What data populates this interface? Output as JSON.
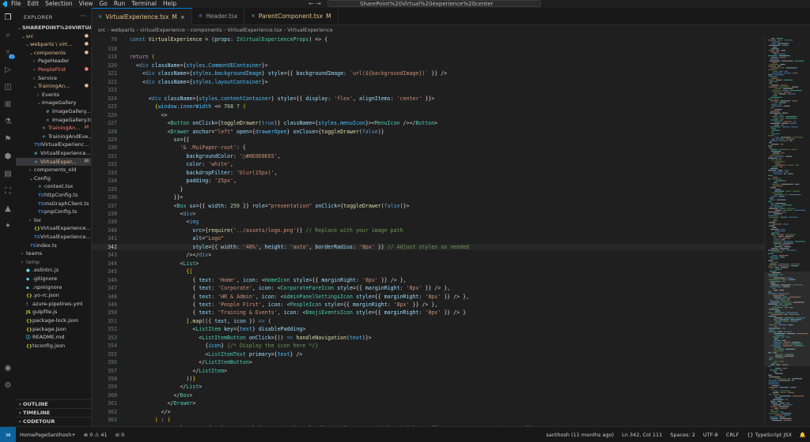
{
  "menubar": [
    "File",
    "Edit",
    "Selection",
    "View",
    "Go",
    "Run",
    "Terminal",
    "Help"
  ],
  "search": {
    "text": "SharePoint%20Virtual%20experience%20center"
  },
  "explorer": {
    "title": "EXPLORER",
    "items": [
      {
        "label": "SHAREPOINT%20VIRTUAL...",
        "color": "c-white",
        "chev": "⌄",
        "indent": 0,
        "badge": "",
        "bold": true
      },
      {
        "label": "src",
        "color": "c-orange",
        "chev": "⌄",
        "indent": 1,
        "badge": "●"
      },
      {
        "label": "webparts \\ virt...",
        "color": "c-orange",
        "chev": "⌄",
        "indent": 2,
        "badge": "●"
      },
      {
        "label": "components",
        "color": "c-orange",
        "chev": "⌄",
        "indent": 3,
        "badge": "●"
      },
      {
        "label": "PageHeader",
        "color": "c-white",
        "chev": "›",
        "indent": 4,
        "badge": ""
      },
      {
        "label": "PeopleFirst",
        "color": "c-red",
        "chev": "›",
        "indent": 4,
        "badge": "●"
      },
      {
        "label": "Service",
        "color": "c-white",
        "chev": "›",
        "indent": 4,
        "badge": ""
      },
      {
        "label": "TrainingAn...",
        "color": "c-orange",
        "chev": "⌄",
        "indent": 4,
        "badge": "●"
      },
      {
        "label": "Events",
        "color": "c-white",
        "chev": "›",
        "indent": 5,
        "badge": ""
      },
      {
        "label": "ImageGallery",
        "color": "c-white",
        "chev": "⌄",
        "indent": 5,
        "badge": ""
      },
      {
        "label": "ImageGallery...",
        "color": "c-white",
        "chev": "",
        "indent": 6,
        "badge": "",
        "icon": "#"
      },
      {
        "label": "ImageGallery.tsx",
        "color": "c-white",
        "chev": "",
        "indent": 6,
        "badge": "",
        "icon": "⚛"
      },
      {
        "label": "TrainingAn...",
        "color": "c-red",
        "chev": "",
        "indent": 5,
        "badge": "M",
        "icon": "⚛"
      },
      {
        "label": "TrainingAndEve...",
        "color": "c-white",
        "chev": "",
        "indent": 5,
        "badge": "",
        "icon": "⚛"
      },
      {
        "label": "IVirtualExperienc...",
        "color": "c-white",
        "chev": "",
        "indent": 3,
        "badge": "",
        "icon": "TS"
      },
      {
        "label": "VirtualExperience...",
        "color": "c-white",
        "chev": "",
        "indent": 3,
        "badge": "",
        "icon": "#"
      },
      {
        "label": "VirtualExper...",
        "color": "c-orange",
        "chev": "",
        "indent": 3,
        "badge": "M",
        "icon": "⚛",
        "selected": true
      },
      {
        "label": "components_old",
        "color": "c-white",
        "chev": "›",
        "indent": 3,
        "badge": ""
      },
      {
        "label": "Config",
        "color": "c-white",
        "chev": "⌄",
        "indent": 3,
        "badge": ""
      },
      {
        "label": "context.tsx",
        "color": "c-white",
        "chev": "",
        "indent": 4,
        "badge": "",
        "icon": "⚛"
      },
      {
        "label": "httpConfig.ts",
        "color": "c-white",
        "chev": "",
        "indent": 4,
        "badge": "",
        "icon": "TS"
      },
      {
        "label": "msGraphClient.ts",
        "color": "c-white",
        "chev": "",
        "indent": 4,
        "badge": "",
        "icon": "TS"
      },
      {
        "label": "pnpConfig.ts",
        "color": "c-white",
        "chev": "",
        "indent": 4,
        "badge": "",
        "icon": "TS"
      },
      {
        "label": "loc",
        "color": "c-white",
        "chev": "›",
        "indent": 3,
        "badge": ""
      },
      {
        "label": "VirtualExperience...",
        "color": "c-white",
        "chev": "",
        "indent": 3,
        "badge": "",
        "icon": "{}"
      },
      {
        "label": "VirtualExperience...",
        "color": "c-white",
        "chev": "",
        "indent": 3,
        "badge": "",
        "icon": "TS"
      },
      {
        "label": "index.ts",
        "color": "c-white",
        "chev": "",
        "indent": 2,
        "badge": "",
        "icon": "TS"
      },
      {
        "label": "teams",
        "color": "c-white",
        "chev": "›",
        "indent": 1,
        "badge": ""
      },
      {
        "label": "temp",
        "color": "c-gray",
        "chev": "›",
        "indent": 1,
        "badge": ""
      },
      {
        "label": ".eslintrc.js",
        "color": "c-white",
        "chev": "",
        "indent": 1,
        "badge": "",
        "icon": "●"
      },
      {
        "label": ".gitignore",
        "color": "c-white",
        "chev": "",
        "indent": 1,
        "badge": "",
        "icon": "◆"
      },
      {
        "label": ".npmignore",
        "color": "c-white",
        "chev": "",
        "indent": 1,
        "badge": "",
        "icon": "▪"
      },
      {
        "label": ".yo-rc.json",
        "color": "c-white",
        "chev": "",
        "indent": 1,
        "badge": "",
        "icon": "{}"
      },
      {
        "label": "azure-pipelines.yml",
        "color": "c-white",
        "chev": "",
        "indent": 1,
        "badge": "",
        "icon": "!"
      },
      {
        "label": "gulpfile.js",
        "color": "c-white",
        "chev": "",
        "indent": 1,
        "badge": "",
        "icon": "JS"
      },
      {
        "label": "package-lock.json",
        "color": "c-white",
        "chev": "",
        "indent": 1,
        "badge": "",
        "icon": "{}"
      },
      {
        "label": "package.json",
        "color": "c-white",
        "chev": "",
        "indent": 1,
        "badge": "",
        "icon": "{}"
      },
      {
        "label": "README.md",
        "color": "c-white",
        "chev": "",
        "indent": 1,
        "badge": "",
        "icon": "ⓘ"
      },
      {
        "label": "tsconfig.json",
        "color": "c-white",
        "chev": "",
        "indent": 1,
        "badge": "",
        "icon": "{}"
      }
    ],
    "sections": [
      "OUTLINE",
      "TIMELINE",
      "CODETOUR"
    ]
  },
  "tabs": [
    {
      "label": "VirtualExperience.tsx",
      "mod": "M",
      "active": true
    },
    {
      "label": "Header.tsx",
      "mod": "",
      "active": false
    },
    {
      "label": "ParentComponent.tsx",
      "mod": "M",
      "active": false
    }
  ],
  "breadcrumb": [
    "src",
    "webparts",
    "virtualExperience",
    "components",
    "VirtualExperience.tsx",
    "VirtualExperience"
  ],
  "sticky": {
    "line": "76",
    "html": "  <span class='k'>const</span> <span class='f'>VirtualExperience</span> <span class='p'>= (</span><span class='a'>props</span><span class='p'>: </span><span class='t'>IVirtualExperienceProps</span><span class='p'>) =&gt; {</span>"
  },
  "code": [
    {
      "n": "318",
      "h": ""
    },
    {
      "n": "319",
      "h": "  <span class='kc'>return</span> <span class='br'>(</span>"
    },
    {
      "n": "320",
      "h": "    <span class='p'>&lt;</span><span class='k'>div</span> <span class='a'>className</span><span class='p'>={</span><span class='v'>styles</span><span class='p'>.</span><span class='v'>CommonVEContainer</span><span class='p'>}&gt;</span>"
    },
    {
      "n": "321",
      "h": "      <span class='p'>&lt;</span><span class='k'>div</span> <span class='a'>className</span><span class='p'>={</span><span class='v'>styles</span><span class='p'>.</span><span class='v'>backgroundImage</span><span class='p'>}</span> <span class='a'>style</span><span class='p'>={{</span> <span class='a'>backgroundImage</span><span class='p'>:</span> <span class='s'>`url(${backgroundImage})`</span> <span class='p'>}}</span> <span class='p'>/&gt;</span>"
    },
    {
      "n": "322",
      "h": "      <span class='p'>&lt;</span><span class='k'>div</span> <span class='a'>className</span><span class='p'>={</span><span class='v'>styles</span><span class='p'>.</span><span class='v'>layoutContainer</span><span class='p'>}&gt;</span>"
    },
    {
      "n": "323",
      "h": ""
    },
    {
      "n": "324",
      "h": "        <span class='p'>&lt;</span><span class='k'>div</span> <span class='a'>className</span><span class='p'>={</span><span class='v'>styles</span><span class='p'>.</span><span class='v'>contentContainer</span><span class='p'>}</span> <span class='a'>style</span><span class='p'>={{</span> <span class='a'>display</span><span class='p'>:</span> <span class='s'>'flex'</span><span class='p'>,</span> <span class='a'>alignItems</span><span class='p'>:</span> <span class='s'>'center'</span> <span class='p'>}}&gt;</span>"
    },
    {
      "n": "325",
      "h": "          <span class='br'>{</span><span class='v'>window</span><span class='p'>.</span><span class='v'>innerWidth</span> <span class='p'>&lt;=</span> <span class='n'>768</span> <span class='p'>?</span> <span class='br'>(</span>"
    },
    {
      "n": "326",
      "h": "            <span class='p'>&lt;&gt;</span>"
    },
    {
      "n": "327",
      "h": "              <span class='p'>&lt;</span><span class='t'>Button</span> <span class='a'>onClick</span><span class='p'>={</span><span class='f'>toggleDrawer</span><span class='p'>(</span><span class='k'>true</span><span class='p'>)}</span> <span class='a'>className</span><span class='p'>={</span><span class='v'>styles</span><span class='p'>.</span><span class='v'>menuIcon</span><span class='p'>}&gt;&lt;</span><span class='t'>MenuIcon</span> <span class='p'>/&gt;&lt;/</span><span class='t'>Button</span><span class='p'>&gt;</span>"
    },
    {
      "n": "328",
      "h": "              <span class='p'>&lt;</span><span class='t'>Drawer</span> <span class='a'>anchor</span><span class='p'>=</span><span class='s'>\"left\"</span> <span class='a'>open</span><span class='p'>={</span><span class='v'>drawerOpen</span><span class='p'>}</span> <span class='a'>onClose</span><span class='p'>={</span><span class='f'>toggleDrawer</span><span class='p'>(</span><span class='k'>false</span><span class='p'>)}</span>"
    },
    {
      "n": "329",
      "h": "                <span class='a'>sx</span><span class='p'>={{</span>"
    },
    {
      "n": "330",
      "h": "                  <span class='s'>'&amp; .MuiPaper-root'</span><span class='p'>: {</span>"
    },
    {
      "n": "331",
      "h": "                    <span class='a'>backgroundColor</span><span class='p'>:</span> <span class='s'>'▢#0E0E0E65'</span><span class='p'>,</span>"
    },
    {
      "n": "332",
      "h": "                    <span class='a'>color</span><span class='p'>:</span> <span class='s'>'white'</span><span class='p'>,</span>"
    },
    {
      "n": "333",
      "h": "                    <span class='a'>backdropFilter</span><span class='p'>:</span> <span class='s'>'blur(15px)'</span><span class='p'>,</span>"
    },
    {
      "n": "334",
      "h": "                    <span class='a'>padding</span><span class='p'>:</span> <span class='s'>'25px'</span><span class='p'>,</span>"
    },
    {
      "n": "335",
      "h": "                  <span class='p'>}</span>"
    },
    {
      "n": "336",
      "h": "                <span class='p'>}}&gt;</span>"
    },
    {
      "n": "337",
      "h": "                <span class='p'>&lt;</span><span class='t'>Box</span> <span class='a'>sx</span><span class='p'>={{</span> <span class='a'>width</span><span class='p'>:</span> <span class='n'>250</span> <span class='p'>}}</span> <span class='a'>role</span><span class='p'>=</span><span class='s'>\"presentation\"</span> <span class='a'>onClick</span><span class='p'>={</span><span class='f'>toggleDrawer</span><span class='p'>(</span><span class='k'>false</span><span class='p'>)}&gt;</span>"
    },
    {
      "n": "338",
      "h": "                  <span class='p'>&lt;</span><span class='k'>div</span><span class='p'>&gt;</span>"
    },
    {
      "n": "339",
      "h": "                    <span class='p'>&lt;</span><span class='k'>img</span>"
    },
    {
      "n": "340",
      "h": "                      <span class='a'>src</span><span class='p'>={</span><span class='f'>require</span><span class='p'>(</span><span class='s'>'../assets/logo.png'</span><span class='p'>)}</span> <span class='cm'>// Replace with your image path</span>"
    },
    {
      "n": "341",
      "h": "                      <span class='a'>alt</span><span class='p'>=</span><span class='s'>\"Logo\"</span>"
    },
    {
      "n": "342",
      "h": "                      <span class='a'>style</span><span class='p'>={{</span> <span class='a'>width</span><span class='p'>:</span> <span class='s'>'48%'</span><span class='p'>,</span> <span class='a'>height</span><span class='p'>:</span> <span class='s'>'auto'</span><span class='p'>,</span> <span class='a'>borderRadius</span><span class='p'>:</span> <span class='s'>'8px'</span> <span class='p'>}}</span> <span class='cm'>// Adjust styles as needed</span>",
      "current": true
    },
    {
      "n": "343",
      "h": "                    <span class='p'>/&gt;&lt;/</span><span class='k'>div</span><span class='p'>&gt;</span>"
    },
    {
      "n": "344",
      "h": "                  <span class='p'>&lt;</span><span class='t'>List</span><span class='p'>&gt;</span>"
    },
    {
      "n": "345",
      "h": "                    <span class='br'>{[</span>"
    },
    {
      "n": "346",
      "h": "                      <span class='p'>{</span> <span class='a'>text</span><span class='p'>:</span> <span class='s'>'Home'</span><span class='p'>,</span> <span class='a'>icon</span><span class='p'>:</span> <span class='p'>&lt;</span><span class='t'>HomeIcon</span> <span class='a'>style</span><span class='p'>={{</span> <span class='a'>marginRight</span><span class='p'>:</span> <span class='s'>'8px'</span> <span class='p'>}}</span> <span class='p'>/&gt;</span> <span class='p'>},</span>"
    },
    {
      "n": "347",
      "h": "                      <span class='p'>{</span> <span class='a'>text</span><span class='p'>:</span> <span class='s'>'Corporate'</span><span class='p'>,</span> <span class='a'>icon</span><span class='p'>:</span> <span class='p'>&lt;</span><span class='t'>CorporateFareIcon</span> <span class='a'>style</span><span class='p'>={{</span> <span class='a'>marginRight</span><span class='p'>:</span> <span class='s'>'8px'</span> <span class='p'>}}</span> <span class='p'>/&gt;</span> <span class='p'>},</span>"
    },
    {
      "n": "348",
      "h": "                      <span class='p'>{</span> <span class='a'>text</span><span class='p'>:</span> <span class='s'>'HR &amp; Admin'</span><span class='p'>,</span> <span class='a'>icon</span><span class='p'>:</span> <span class='p'>&lt;</span><span class='t'>AdminPanelSettingsIcon</span> <span class='a'>style</span><span class='p'>={{</span> <span class='a'>marginRight</span><span class='p'>:</span> <span class='s'>'8px'</span> <span class='p'>}}</span> <span class='p'>/&gt;</span> <span class='p'>},</span>"
    },
    {
      "n": "349",
      "h": "                      <span class='p'>{</span> <span class='a'>text</span><span class='p'>:</span> <span class='s'>'People First'</span><span class='p'>,</span> <span class='a'>icon</span><span class='p'>:</span> <span class='p'>&lt;</span><span class='t'>PeopleIcon</span> <span class='a'>style</span><span class='p'>={{</span> <span class='a'>marginRight</span><span class='p'>:</span> <span class='s'>'8px'</span> <span class='p'>}}</span> <span class='p'>/&gt;</span> <span class='p'>},</span>"
    },
    {
      "n": "350",
      "h": "                      <span class='p'>{</span> <span class='a'>text</span><span class='p'>:</span> <span class='s'>'Training &amp; Events'</span><span class='p'>,</span> <span class='a'>icon</span><span class='p'>:</span> <span class='p'>&lt;</span><span class='t'>EmojiEventsIcon</span> <span class='a'>style</span><span class='p'>={{</span> <span class='a'>marginRight</span><span class='p'>:</span> <span class='s'>'8px'</span> <span class='p'>}}</span> <span class='p'>/&gt;</span> <span class='p'>}</span>"
    },
    {
      "n": "351",
      "h": "                    <span class='br'>]</span><span class='p'>.</span><span class='f'>map</span><span class='p'>((</span><span class='p'>{</span> <span class='a'>text</span><span class='p'>,</span> <span class='a'>icon</span> <span class='p'>})</span> <span class='k'>=&gt;</span> <span class='p'>(</span>"
    },
    {
      "n": "352",
      "h": "                      <span class='p'>&lt;</span><span class='t'>ListItem</span> <span class='a'>key</span><span class='p'>={</span><span class='v'>text</span><span class='p'>}</span> <span class='a'>disablePadding</span><span class='p'>&gt;</span>"
    },
    {
      "n": "353",
      "h": "                        <span class='p'>&lt;</span><span class='t'>ListItemButton</span> <span class='a'>onClick</span><span class='p'>={()</span> <span class='k'>=&gt;</span> <span class='f'>handleNavigation</span><span class='p'>(</span><span class='v'>text</span><span class='p'>)}&gt;</span>"
    },
    {
      "n": "354",
      "h": "                          <span class='p'>{</span><span class='v'>icon</span><span class='p'>}</span> <span class='cm'>{/* Display the icon here */}</span>"
    },
    {
      "n": "355",
      "h": "                          <span class='p'>&lt;</span><span class='t'>ListItemText</span> <span class='a'>primary</span><span class='p'>={</span><span class='v'>text</span><span class='p'>}</span> <span class='p'>/&gt;</span>"
    },
    {
      "n": "356",
      "h": "                        <span class='p'>&lt;/</span><span class='t'>ListItemButton</span><span class='p'>&gt;</span>"
    },
    {
      "n": "357",
      "h": "                      <span class='p'>&lt;/</span><span class='t'>ListItem</span><span class='p'>&gt;</span>"
    },
    {
      "n": "358",
      "h": "                    <span class='p'>))</span><span class='br'>}</span>"
    },
    {
      "n": "359",
      "h": "                  <span class='p'>&lt;/</span><span class='t'>List</span><span class='p'>&gt;</span>"
    },
    {
      "n": "360",
      "h": "                <span class='p'>&lt;/</span><span class='t'>Box</span><span class='p'>&gt;</span>"
    },
    {
      "n": "361",
      "h": "              <span class='p'>&lt;/</span><span class='t'>Drawer</span><span class='p'>&gt;</span>"
    },
    {
      "n": "362",
      "h": "            <span class='p'>&lt;/&gt;</span>"
    },
    {
      "n": "363",
      "h": "          <span class='br'>)</span> <span class='p'>:</span> <span class='br'>(</span>"
    },
    {
      "n": "364",
      "h": "            <span class='p'>&lt;</span><span class='k'>div</span> <span class='a'>className</span><span class='p'>={</span><span class='v'>styles</span><span class='p'>.</span><span class='v'>HeaderleftContainer</span><span class='p'>}</span> <span class='a'>style</span><span class='p'>={{</span> <span class='a'>justifyContent</span><span class='p'>:</span> <span class='v'>dialogVisible</span> <span class='p'>?</span> <span class='s'>'flex-start'</span> <span class='p'>:</span> <span class='s'>'space-between'</span> <span class='p'>}}&gt;</span>"
    }
  ],
  "status": {
    "branch": "HomePageSanthosh+",
    "problems": "⊗ 0 ⚠ 41",
    "mic": "⊘ 0",
    "blame": "santhosh (11 months ago)",
    "position": "Ln 342, Col 111",
    "spaces": "Spaces: 2",
    "encoding": "UTF-8",
    "eol": "CRLF",
    "language": "{} TypeScript JSX",
    "bell": "🔔"
  }
}
